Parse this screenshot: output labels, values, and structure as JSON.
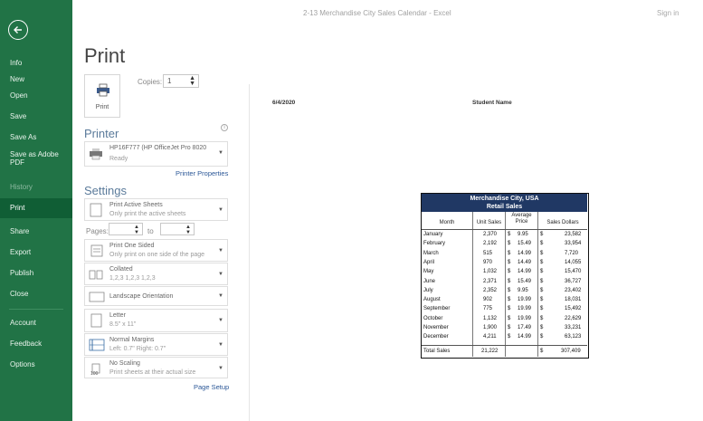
{
  "window": {
    "title": "2-13 Merchandise City Sales Calendar - Excel",
    "signin": "Sign in"
  },
  "sidebar": {
    "items": [
      {
        "label": "Info"
      },
      {
        "label": "New"
      },
      {
        "label": "Open"
      },
      {
        "label": "Save"
      },
      {
        "label": "Save As"
      },
      {
        "label": "Save as Adobe PDF"
      },
      {
        "label": "History"
      },
      {
        "label": "Print"
      },
      {
        "label": "Share"
      },
      {
        "label": "Export"
      },
      {
        "label": "Publish"
      },
      {
        "label": "Close"
      },
      {
        "label": "Account"
      },
      {
        "label": "Feedback"
      },
      {
        "label": "Options"
      }
    ]
  },
  "print": {
    "title": "Print",
    "button_label": "Print",
    "copies_label": "Copies:",
    "copies_value": "1",
    "printer_title": "Printer",
    "printer_name": "HP16F777 (HP OfficeJet Pro 8020",
    "printer_status": "Ready",
    "printer_properties": "Printer Properties",
    "settings_title": "Settings",
    "settings": {
      "active_sheets": {
        "main": "Print Active Sheets",
        "sub": "Only print the active sheets"
      },
      "pages_label": "Pages:",
      "pages_to": "to",
      "one_sided": {
        "main": "Print One Sided",
        "sub": "Only print on one side of the page"
      },
      "collated": {
        "main": "Collated",
        "sub": "1,2,3   1,2,3   1,2,3"
      },
      "orientation": {
        "main": "Landscape Orientation"
      },
      "letter": {
        "main": "Letter",
        "sub": "8.5\" x 11\""
      },
      "margins": {
        "main": "Normal Margins",
        "sub": "Left: 0.7\"   Right: 0.7\""
      },
      "scaling": {
        "main": "No Scaling",
        "sub": "Print sheets at their actual size"
      }
    },
    "page_setup": "Page Setup"
  },
  "preview": {
    "header_date": "6/4/2020",
    "header_name": "Student Name",
    "sheet_title": "Merchandise City, USA",
    "sheet_subtitle": "Retail Sales",
    "columns": {
      "month": "Month",
      "unit_sales": "Unit Sales",
      "avg_price": "Average Price",
      "sales_dollars": "Sales Dollars"
    },
    "rows": [
      {
        "month": "January",
        "units": "2,370",
        "price": "9.95",
        "sales": "23,582"
      },
      {
        "month": "February",
        "units": "2,192",
        "price": "15.49",
        "sales": "33,954"
      },
      {
        "month": "March",
        "units": "515",
        "price": "14.99",
        "sales": "7,720"
      },
      {
        "month": "April",
        "units": "970",
        "price": "14.49",
        "sales": "14,055"
      },
      {
        "month": "May",
        "units": "1,032",
        "price": "14.99",
        "sales": "15,470"
      },
      {
        "month": "June",
        "units": "2,371",
        "price": "15.49",
        "sales": "36,727"
      },
      {
        "month": "July",
        "units": "2,352",
        "price": "9.95",
        "sales": "23,402"
      },
      {
        "month": "August",
        "units": "902",
        "price": "19.99",
        "sales": "18,031"
      },
      {
        "month": "September",
        "units": "775",
        "price": "19.99",
        "sales": "15,492"
      },
      {
        "month": "October",
        "units": "1,132",
        "price": "19.99",
        "sales": "22,629"
      },
      {
        "month": "November",
        "units": "1,900",
        "price": "17.49",
        "sales": "33,231"
      },
      {
        "month": "December",
        "units": "4,211",
        "price": "14.99",
        "sales": "63,123"
      }
    ],
    "total_label": "Total Sales",
    "total_units": "21,222",
    "total_sales": "307,409",
    "currency": "$"
  },
  "colors": {
    "sidebar": "#217346",
    "sidebar_active": "#105e35",
    "sheet_header": "#203864",
    "link": "#2b5797"
  }
}
